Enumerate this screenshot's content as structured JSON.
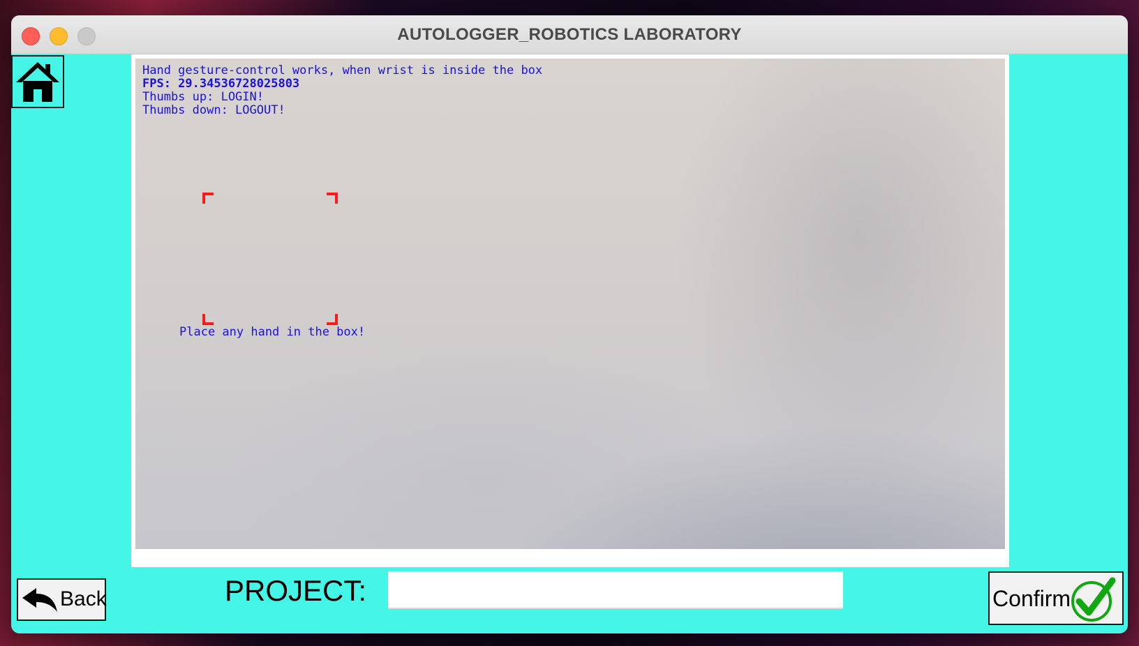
{
  "window": {
    "title": "AUTOLOGGER_ROBOTICS LABORATORY",
    "accent_color": "#45f5e6"
  },
  "toolbar": {
    "home_icon": "home-icon"
  },
  "camera": {
    "overlay_lines": [
      "Hand gesture-control works, when wrist is inside the box",
      "FPS: 29.34536728025803",
      "Thumbs up: LOGIN!",
      "Thumbs down: LOGOUT!"
    ],
    "box_hint": "Place any hand in the box!",
    "overlay_text_color": "#1d12d8",
    "box_color": "#ff1a1a"
  },
  "footer": {
    "back_label": "Back",
    "back_icon": "back-arrow-icon",
    "project_label": "PROJECT:",
    "project_value": "",
    "confirm_label": "Confirm",
    "confirm_icon": "checkmark-icon"
  }
}
